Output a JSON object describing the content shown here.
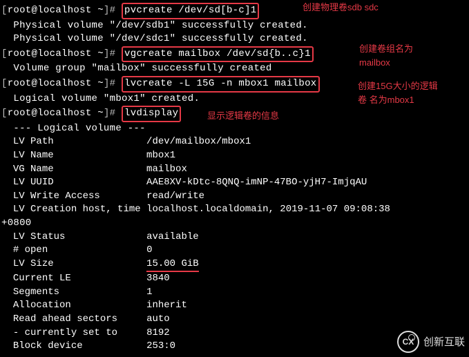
{
  "prompts": {
    "open": "[",
    "user_host": "root@localhost ~",
    "close": "]#"
  },
  "lines": {
    "cmd1": "pvcreate /dev/sd[b-c]1",
    "out1": "  Physical volume \"/dev/sdb1\" successfully created.",
    "out2": "  Physical volume \"/dev/sdc1\" successfully created.",
    "cmd2": "vgcreate mailbox /dev/sd{b..c}1",
    "out3": "  Volume group \"mailbox\" successfully created",
    "cmd3": "lvcreate -L 15G -n mbox1 mailbox",
    "out4": "  Logical volume \"mbox1\" created.",
    "cmd4": "lvdisplay",
    "lv_header": "  --- Logical volume ---"
  },
  "lv": [
    [
      "LV Path",
      "/dev/mailbox/mbox1"
    ],
    [
      "LV Name",
      "mbox1"
    ],
    [
      "VG Name",
      "mailbox"
    ],
    [
      "LV UUID",
      "AAE8XV-kDtc-8QNQ-imNP-47BO-yjH7-ImjqAU"
    ],
    [
      "LV Write Access",
      "read/write"
    ]
  ],
  "lv_creation_label": "LV Creation host, time",
  "lv_creation_value": "localhost.localdomain, 2019-11-07 09:08:38",
  "lv_tz": "+0800",
  "lv2": [
    [
      "LV Status",
      "available"
    ],
    [
      "# open",
      "0"
    ],
    [
      "LV Size",
      "15.00 GiB"
    ],
    [
      "Current LE",
      "3840"
    ],
    [
      "Segments",
      "1"
    ],
    [
      "Allocation",
      "inherit"
    ],
    [
      "Read ahead sectors",
      "auto"
    ],
    [
      "- currently set to",
      "8192"
    ],
    [
      "Block device",
      "253:0"
    ]
  ],
  "annotations": {
    "a1": "创建物理卷sdb  sdc",
    "a2_l1": "创建卷组名为",
    "a2_l2": "mailbox",
    "a3_l1": "创建15G大小的逻辑",
    "a3_l2": "卷 名为mbox1",
    "a4": "显示逻辑卷的信息"
  },
  "watermark": {
    "text": "创新互联",
    "badge": "CX"
  }
}
